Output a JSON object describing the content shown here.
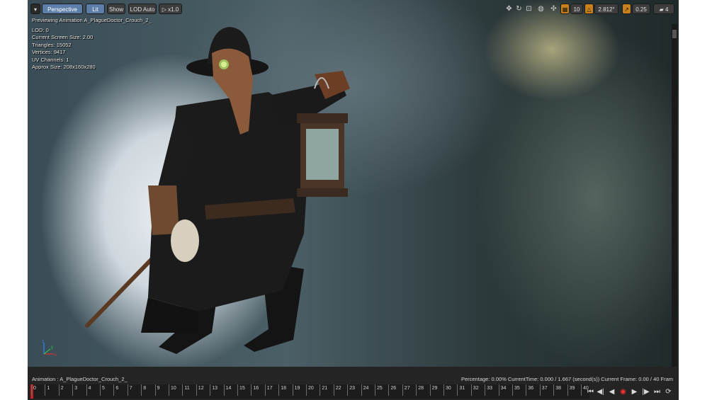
{
  "toolbar": {
    "menu_icon": "chevron-down-icon",
    "perspective_label": "Perspective",
    "lit_label": "Lit",
    "show_label": "Show",
    "lod_label": "LOD Auto",
    "speed_label": "x1.0",
    "grid_snap_value": "10",
    "rotate_snap_value": "2.812°",
    "scale_snap_value": "0.25",
    "camera_speed_value": "4"
  },
  "stats": {
    "previewing": "Previewing Animation A_PlagueDoctor_Crouch_2_",
    "lod": "LOD: 0",
    "screen_size": "Current Screen Size: 2.00",
    "triangles": "Triangles: 15052",
    "vertices": "Vertices: 9417",
    "uv_channels": "UV Channels: 1",
    "approx_size": "Approx Size: 208x160x280"
  },
  "timeline": {
    "animation_label": "Animation : A_PlagueDoctor_Crouch_2_",
    "status": "Percentage: 0.00% CurrentTime: 0.000 / 1.667 (second(s)) Current Frame: 0.00 / 40 Fram",
    "frames": [
      "0",
      "1",
      "2",
      "3",
      "4",
      "5",
      "6",
      "7",
      "8",
      "9",
      "10",
      "11",
      "12",
      "13",
      "14",
      "15",
      "16",
      "17",
      "18",
      "19",
      "20",
      "21",
      "22",
      "23",
      "24",
      "25",
      "26",
      "27",
      "28",
      "29",
      "30",
      "31",
      "32",
      "33",
      "34",
      "35",
      "36",
      "37",
      "38",
      "39",
      "40"
    ]
  },
  "colors": {
    "toolbar_active": "#5d7ea8",
    "snap_active": "#c8801c",
    "scrub_marker": "#c62020",
    "record": "#ff3030"
  }
}
